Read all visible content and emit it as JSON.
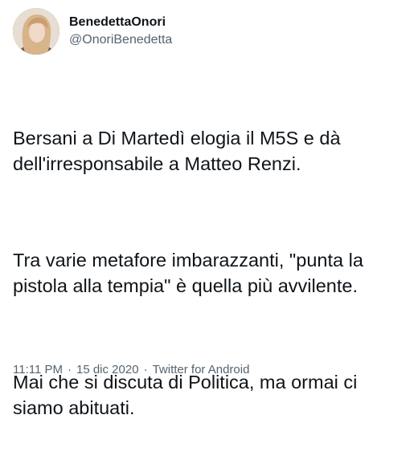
{
  "user": {
    "display_name": "BenedettaOnori",
    "handle": "@OnoriBenedetta"
  },
  "tweet": {
    "paragraphs": [
      "Bersani a Di Martedì elogia il M5S e dà dell'irresponsabile a Matteo Renzi.",
      "Tra varie metafore imbarazzanti, \"punta la pistola alla tempia\" è quella più avvilente.",
      "Mai che si discuta di Politica, ma ormai ci siamo abituati."
    ],
    "time": "11:11 PM",
    "separator": "·",
    "date": "15 dic 2020",
    "source": "Twitter for Android"
  },
  "icons": {
    "avatar": "profile-photo"
  },
  "colors": {
    "text": "#0f1419",
    "secondary": "#536471"
  }
}
